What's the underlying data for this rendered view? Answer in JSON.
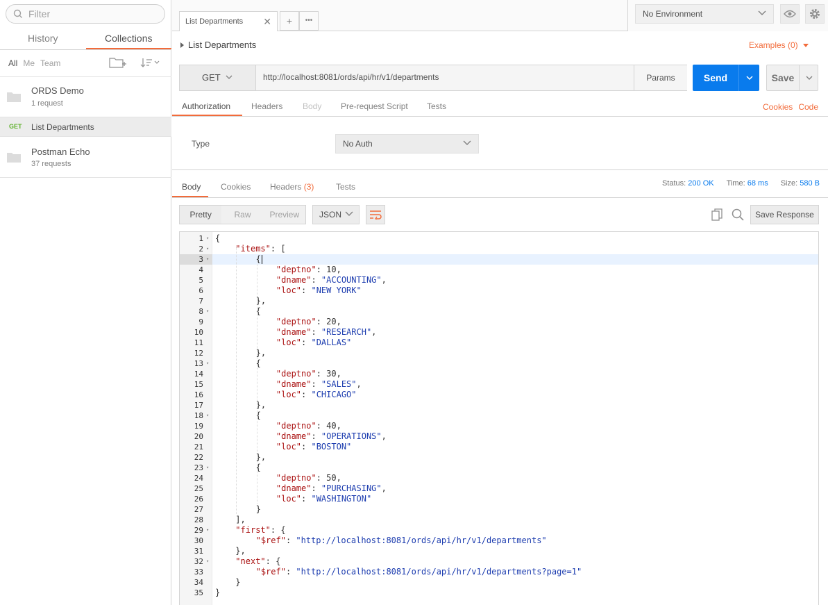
{
  "sidebar": {
    "filter_placeholder": "Filter",
    "tabs": [
      "History",
      "Collections"
    ],
    "owner_filters": [
      "All",
      "Me",
      "Team"
    ],
    "collections": [
      {
        "name": "ORDS Demo",
        "meta": "1 request"
      },
      {
        "name": "Postman Echo",
        "meta": "37 requests"
      }
    ],
    "request": {
      "method": "GET",
      "name": "List Departments"
    }
  },
  "topbar": {
    "tab_label": "List Departments",
    "close_glyph": "✕",
    "add_glyph": "+",
    "more_glyph": "•••",
    "environment": "No Environment"
  },
  "request": {
    "title": "List Departments",
    "examples": "Examples (0)",
    "method": "GET",
    "url": "http://localhost:8081/ords/api/hr/v1/departments",
    "params_label": "Params",
    "send_label": "Send",
    "save_label": "Save",
    "tabs": [
      "Authorization",
      "Headers",
      "Body",
      "Pre-request Script",
      "Tests"
    ],
    "cookies_label": "Cookies",
    "code_label": "Code",
    "auth_type_label": "Type",
    "auth_type_value": "No Auth"
  },
  "response": {
    "tabs": {
      "body": "Body",
      "cookies": "Cookies",
      "headers": "Headers",
      "headers_count": "(3)",
      "tests": "Tests"
    },
    "status_label": "Status:",
    "status_value": "200 OK",
    "time_label": "Time:",
    "time_value": "68 ms",
    "size_label": "Size:",
    "size_value": "580 B",
    "view_modes": [
      "Pretty",
      "Raw",
      "Preview"
    ],
    "format": "JSON",
    "save_response_label": "Save Response"
  },
  "body_lines": [
    {
      "indent": 0,
      "tokens": [
        [
          "p",
          "{"
        ]
      ],
      "fold": true
    },
    {
      "indent": 1,
      "tokens": [
        [
          "k",
          "\"items\""
        ],
        [
          "p",
          ": ["
        ]
      ],
      "fold": true
    },
    {
      "indent": 2,
      "tokens": [
        [
          "p",
          "{"
        ]
      ],
      "fold": true,
      "current": true
    },
    {
      "indent": 3,
      "tokens": [
        [
          "k",
          "\"deptno\""
        ],
        [
          "p",
          ": "
        ],
        [
          "n",
          "10"
        ],
        [
          "p",
          ","
        ]
      ]
    },
    {
      "indent": 3,
      "tokens": [
        [
          "k",
          "\"dname\""
        ],
        [
          "p",
          ": "
        ],
        [
          "s",
          "\"ACCOUNTING\""
        ],
        [
          "p",
          ","
        ]
      ]
    },
    {
      "indent": 3,
      "tokens": [
        [
          "k",
          "\"loc\""
        ],
        [
          "p",
          ": "
        ],
        [
          "s",
          "\"NEW YORK\""
        ]
      ]
    },
    {
      "indent": 2,
      "tokens": [
        [
          "p",
          "},"
        ]
      ]
    },
    {
      "indent": 2,
      "tokens": [
        [
          "p",
          "{"
        ]
      ],
      "fold": true
    },
    {
      "indent": 3,
      "tokens": [
        [
          "k",
          "\"deptno\""
        ],
        [
          "p",
          ": "
        ],
        [
          "n",
          "20"
        ],
        [
          "p",
          ","
        ]
      ]
    },
    {
      "indent": 3,
      "tokens": [
        [
          "k",
          "\"dname\""
        ],
        [
          "p",
          ": "
        ],
        [
          "s",
          "\"RESEARCH\""
        ],
        [
          "p",
          ","
        ]
      ]
    },
    {
      "indent": 3,
      "tokens": [
        [
          "k",
          "\"loc\""
        ],
        [
          "p",
          ": "
        ],
        [
          "s",
          "\"DALLAS\""
        ]
      ]
    },
    {
      "indent": 2,
      "tokens": [
        [
          "p",
          "},"
        ]
      ]
    },
    {
      "indent": 2,
      "tokens": [
        [
          "p",
          "{"
        ]
      ],
      "fold": true
    },
    {
      "indent": 3,
      "tokens": [
        [
          "k",
          "\"deptno\""
        ],
        [
          "p",
          ": "
        ],
        [
          "n",
          "30"
        ],
        [
          "p",
          ","
        ]
      ]
    },
    {
      "indent": 3,
      "tokens": [
        [
          "k",
          "\"dname\""
        ],
        [
          "p",
          ": "
        ],
        [
          "s",
          "\"SALES\""
        ],
        [
          "p",
          ","
        ]
      ]
    },
    {
      "indent": 3,
      "tokens": [
        [
          "k",
          "\"loc\""
        ],
        [
          "p",
          ": "
        ],
        [
          "s",
          "\"CHICAGO\""
        ]
      ]
    },
    {
      "indent": 2,
      "tokens": [
        [
          "p",
          "},"
        ]
      ]
    },
    {
      "indent": 2,
      "tokens": [
        [
          "p",
          "{"
        ]
      ],
      "fold": true
    },
    {
      "indent": 3,
      "tokens": [
        [
          "k",
          "\"deptno\""
        ],
        [
          "p",
          ": "
        ],
        [
          "n",
          "40"
        ],
        [
          "p",
          ","
        ]
      ]
    },
    {
      "indent": 3,
      "tokens": [
        [
          "k",
          "\"dname\""
        ],
        [
          "p",
          ": "
        ],
        [
          "s",
          "\"OPERATIONS\""
        ],
        [
          "p",
          ","
        ]
      ]
    },
    {
      "indent": 3,
      "tokens": [
        [
          "k",
          "\"loc\""
        ],
        [
          "p",
          ": "
        ],
        [
          "s",
          "\"BOSTON\""
        ]
      ]
    },
    {
      "indent": 2,
      "tokens": [
        [
          "p",
          "},"
        ]
      ]
    },
    {
      "indent": 2,
      "tokens": [
        [
          "p",
          "{"
        ]
      ],
      "fold": true
    },
    {
      "indent": 3,
      "tokens": [
        [
          "k",
          "\"deptno\""
        ],
        [
          "p",
          ": "
        ],
        [
          "n",
          "50"
        ],
        [
          "p",
          ","
        ]
      ]
    },
    {
      "indent": 3,
      "tokens": [
        [
          "k",
          "\"dname\""
        ],
        [
          "p",
          ": "
        ],
        [
          "s",
          "\"PURCHASING\""
        ],
        [
          "p",
          ","
        ]
      ]
    },
    {
      "indent": 3,
      "tokens": [
        [
          "k",
          "\"loc\""
        ],
        [
          "p",
          ": "
        ],
        [
          "s",
          "\"WASHINGTON\""
        ]
      ]
    },
    {
      "indent": 2,
      "tokens": [
        [
          "p",
          "}"
        ]
      ]
    },
    {
      "indent": 1,
      "tokens": [
        [
          "p",
          "],"
        ]
      ]
    },
    {
      "indent": 1,
      "tokens": [
        [
          "k",
          "\"first\""
        ],
        [
          "p",
          ": {"
        ]
      ],
      "fold": true
    },
    {
      "indent": 2,
      "tokens": [
        [
          "k",
          "\"$ref\""
        ],
        [
          "p",
          ": "
        ],
        [
          "s",
          "\"http://localhost:8081/ords/api/hr/v1/departments\""
        ]
      ]
    },
    {
      "indent": 1,
      "tokens": [
        [
          "p",
          "},"
        ]
      ]
    },
    {
      "indent": 1,
      "tokens": [
        [
          "k",
          "\"next\""
        ],
        [
          "p",
          ": {"
        ]
      ],
      "fold": true
    },
    {
      "indent": 2,
      "tokens": [
        [
          "k",
          "\"$ref\""
        ],
        [
          "p",
          ": "
        ],
        [
          "s",
          "\"http://localhost:8081/ords/api/hr/v1/departments?page=1\""
        ]
      ]
    },
    {
      "indent": 1,
      "tokens": [
        [
          "p",
          "}"
        ]
      ]
    },
    {
      "indent": 0,
      "tokens": [
        [
          "p",
          "}"
        ]
      ]
    }
  ],
  "colors": {
    "accent": "#f26b3a",
    "send": "#097bed",
    "get_method": "#5fb12b"
  }
}
